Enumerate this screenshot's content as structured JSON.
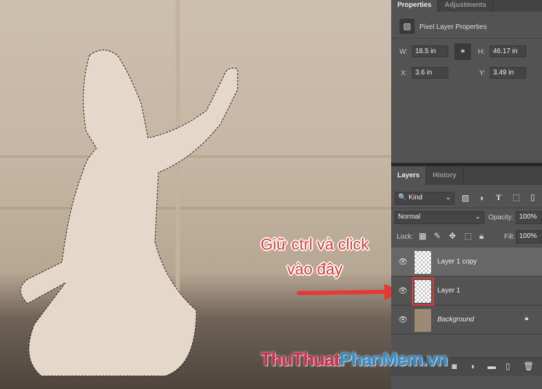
{
  "properties": {
    "tabs": [
      "Properties",
      "Adjustments"
    ],
    "title": "Pixel Layer Properties",
    "w_label": "W:",
    "w": "18.5 in",
    "h_label": "H:",
    "h": "46.17 in",
    "x_label": "X:",
    "x": "3.6 in",
    "y_label": "Y:",
    "y": "3.49 in"
  },
  "layers": {
    "tabs": [
      "Layers",
      "History"
    ],
    "filter": "Kind",
    "blend": "Normal",
    "opacity_label": "Opacity:",
    "opacity": "100%",
    "lock_label": "Lock:",
    "fill_label": "Fill:",
    "fill": "100%",
    "items": [
      {
        "name": "Layer 1 copy"
      },
      {
        "name": "Layer 1"
      },
      {
        "name": "Background"
      }
    ]
  },
  "annotation": {
    "line1": "Giữ ctrl và click",
    "line2": "vào đây",
    "color": "#e53935"
  },
  "watermark": {
    "part1": "ThuThuat",
    "part2": "PhanMem",
    "part3": ".vn"
  }
}
